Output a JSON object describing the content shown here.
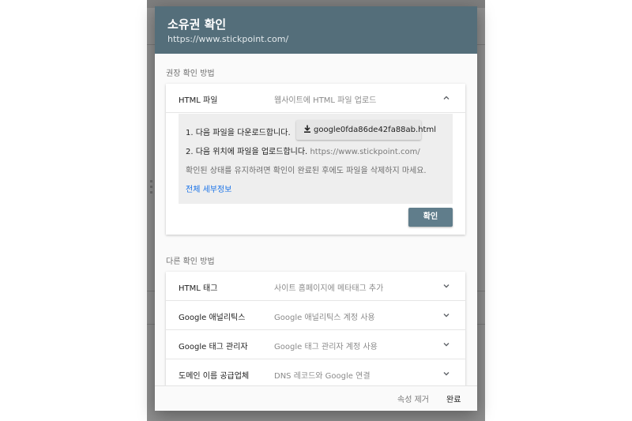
{
  "dialog": {
    "title": "소유권 확인",
    "url": "https://www.stickpoint.com/"
  },
  "recommended": {
    "section_label": "권장 확인 방법",
    "method_name": "HTML 파일",
    "method_desc": "웹사이트에 HTML 파일 업로드",
    "step1": "1. 다음 파일을 다운로드합니다.",
    "download_file": "google0fda86de42fa88ab.html",
    "step2": "2. 다음 위치에 파일을 업로드합니다.",
    "step2_url": "https://www.stickpoint.com/",
    "note": "확인된 상태를 유지하려면 확인이 완료된 후에도 파일을 삭제하지 마세요.",
    "details_link": "전체 세부정보",
    "confirm_button": "확인"
  },
  "other": {
    "section_label": "다른 확인 방법",
    "methods": [
      {
        "name": "HTML 태그",
        "desc": "사이트 홈페이지에 메타태그 추가"
      },
      {
        "name": "Google 애널리틱스",
        "desc": "Google 애널리틱스 계정 사용"
      },
      {
        "name": "Google 태그 관리자",
        "desc": "Google 태그 관리자 계정 사용"
      },
      {
        "name": "도메인 이름 공급업체",
        "desc": "DNS 레코드와 Google 연결"
      }
    ]
  },
  "footer": {
    "remove_label": "속성 제거",
    "done_label": "완료"
  },
  "colors": {
    "header": "#546e7a",
    "primary_button": "#607d8b",
    "link": "#1a73e8"
  },
  "icons": [
    "chevron-up-icon",
    "chevron-down-icon",
    "download-icon"
  ]
}
